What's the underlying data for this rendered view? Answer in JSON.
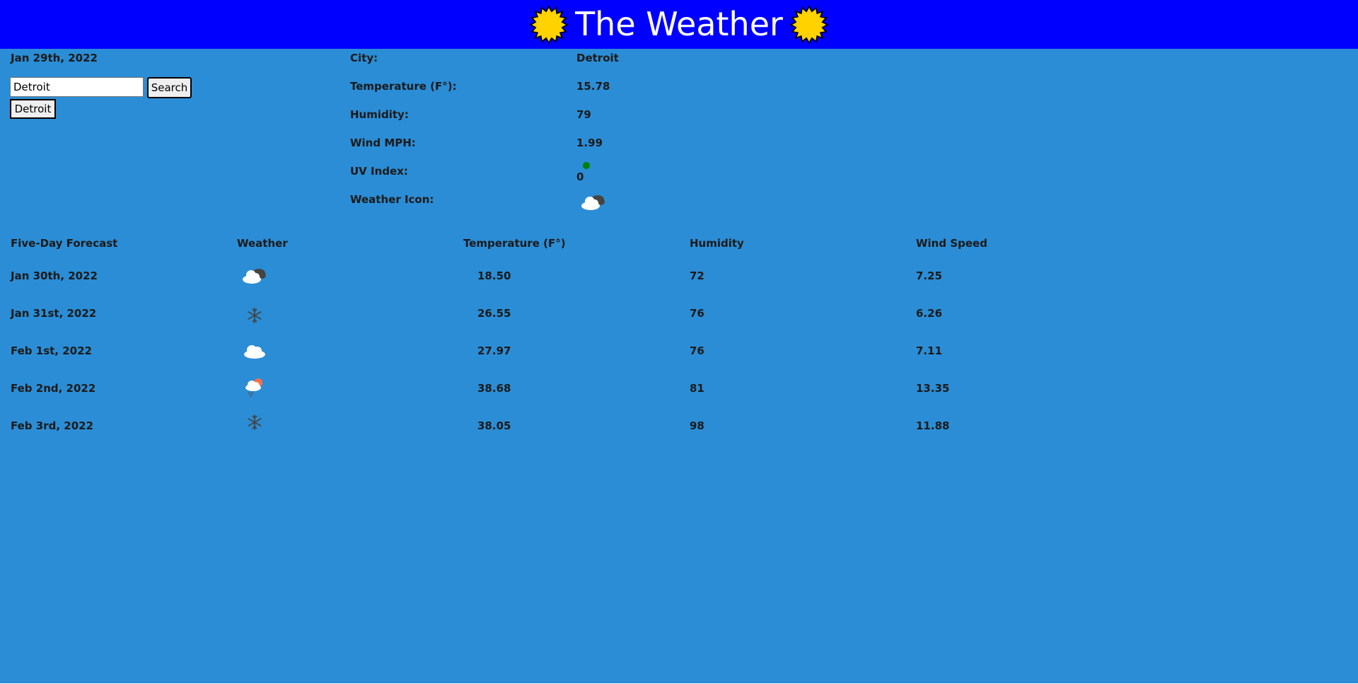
{
  "header": {
    "title": "The Weather",
    "background": "#0000ff",
    "left_icon": "sun-icon",
    "right_icon": "sun-icon"
  },
  "main": {
    "background": "#2b8dd5"
  },
  "current_date": "Jan 29th, 2022",
  "search": {
    "input_value": "Detroit",
    "button_label": "Search",
    "history": [
      "Detroit"
    ]
  },
  "current": {
    "city_label": "City:",
    "city_value": "Detroit",
    "temp_label": "Temperature (F°):",
    "temp_value": "15.78",
    "humidity_label": "Humidity:",
    "humidity_value": "79",
    "wind_label": "Wind MPH:",
    "wind_value": "1.99",
    "uv_label": "UV Index:",
    "uv_value": "0",
    "uv_color": "#008000",
    "icon_label": "Weather Icon:",
    "icon": "cloud-dark-icon"
  },
  "forecast": {
    "headers": [
      "Five-Day Forecast",
      "Weather",
      "Temperature (F°)",
      "Humidity",
      "Wind Speed"
    ],
    "rows": [
      {
        "date": "Jan 30th, 2022",
        "icon": "cloud-dark-icon",
        "temp": "18.50",
        "humidity": "72",
        "wind": "7.25"
      },
      {
        "date": "Jan 31st, 2022",
        "icon": "snowflake-icon",
        "temp": "26.55",
        "humidity": "76",
        "wind": "6.26"
      },
      {
        "date": "Feb 1st, 2022",
        "icon": "cloud-icon",
        "temp": "27.97",
        "humidity": "76",
        "wind": "7.11"
      },
      {
        "date": "Feb 2nd, 2022",
        "icon": "rain-sun-icon",
        "temp": "38.68",
        "humidity": "81",
        "wind": "13.35"
      },
      {
        "date": "Feb 3rd, 2022",
        "icon": "snowflake-icon",
        "temp": "38.05",
        "humidity": "98",
        "wind": "11.88"
      }
    ]
  }
}
